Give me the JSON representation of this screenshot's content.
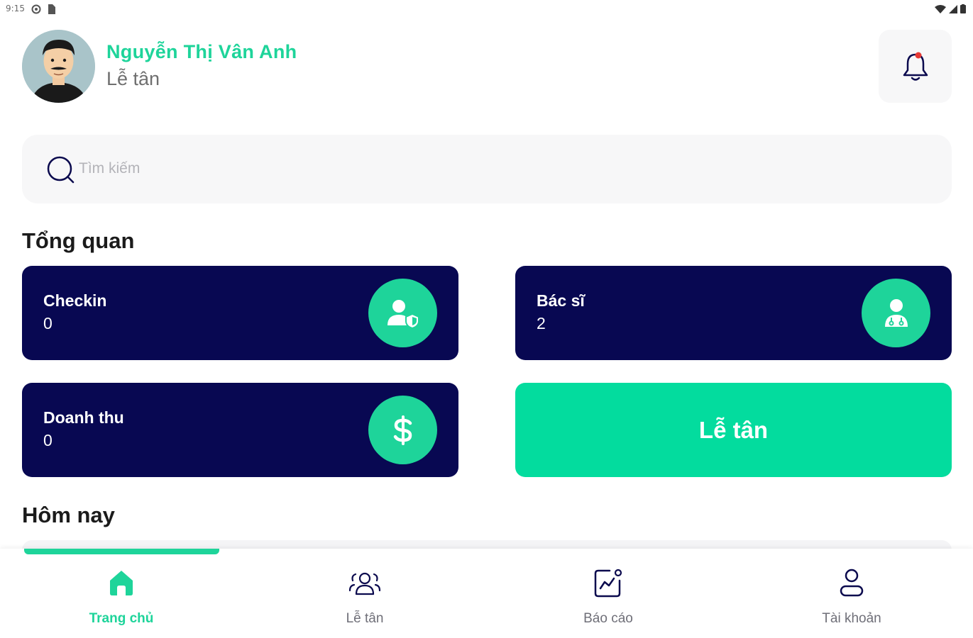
{
  "status_bar": {
    "time": "9:15"
  },
  "header": {
    "user_name": "Nguyễn Thị Vân Anh",
    "user_role": "Lễ tân"
  },
  "search": {
    "placeholder": "Tìm kiếm"
  },
  "overview": {
    "title": "Tổng quan",
    "cards": [
      {
        "label": "Checkin",
        "value": "0",
        "icon": "user-shield-icon"
      },
      {
        "label": "Bác sĩ",
        "value": "2",
        "icon": "doctor-icon"
      },
      {
        "label": "Doanh thu",
        "value": "0",
        "icon": "dollar-icon"
      }
    ],
    "reception_button": "Lễ tân"
  },
  "today": {
    "title": "Hôm nay"
  },
  "bottom_nav": {
    "items": [
      {
        "label": "Trang chủ",
        "icon": "home-icon",
        "active": true
      },
      {
        "label": "Lễ tân",
        "icon": "group-icon",
        "active": false
      },
      {
        "label": "Báo cáo",
        "icon": "chart-icon",
        "active": false
      },
      {
        "label": "Tài khoản",
        "icon": "user-icon",
        "active": false
      }
    ]
  },
  "colors": {
    "accent": "#1ed49a",
    "card_bg": "#080852",
    "button_bg": "#03dc9e"
  }
}
